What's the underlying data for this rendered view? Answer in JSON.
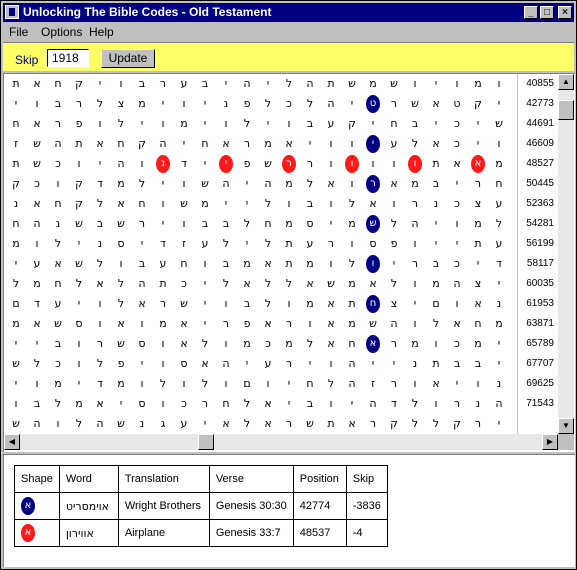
{
  "window": {
    "title": "Unlocking The Bible Codes - Old Testament"
  },
  "menu": [
    "File",
    "Options",
    "Help"
  ],
  "toolbar": {
    "skip_label": "Skip",
    "skip_value": "1918",
    "update_label": "Update"
  },
  "grid": {
    "rows": [
      "ומויושמשתהליהיבערבויקחאתלאהבתוםי",
      "יקטאשרהיהלכלפניוימצלרבויברכיהוהאל",
      "שיכיבחיקעבוילוימוילופראחר",
      "ויכאלעשוויאמראחיהקחאתהשזמוינצא",
      "משאתחוואורנשפוידלוהיוכשתחרהויהם",
      "חריבמאדואלמהיהשוילמדקוכקלתהיתכו",
      "עצכנרואלובוליימשוחאלקחאנתאמוריי",
      "למויהלומיסמחלבבוירשבשנהחליםיונה",
      "עתייופסורעתלילעזדיסנילומויליה",
      "דיכבריאלומתאמבוחעבולשאעיהלצשמית",
      "יצהמולאמשאללאליכתהלאלחמלויועדם",
      "נאוםיצמתאמולבוישראלויעדםיחינימויה",
      "מחאלוהשמאוראפריאמואוסשאמרשביה",
      "ימכומרוחאלמכמולאוסשרובייונתיכם",
      "יבבתנייהוירעיהאסויפלוכלשיתויקחו",
      "נויאורזהלחיוםולולומדימויחיהמרה",
      "הנרולדהיוביאלחרכוסיאמלבוויחקיחעשותי",
      "ירקללקראתשראלאיעגנשהלוהשאלקהי"
    ],
    "positions": [
      "40855",
      "42773",
      "44691",
      "46609",
      "48527",
      "50445",
      "52363",
      "54281",
      "56199",
      "58117",
      "60035",
      "61953",
      "63871",
      "65789",
      "67707",
      "69625",
      "71543"
    ]
  },
  "results": {
    "headers": [
      "Shape",
      "Word",
      "Translation",
      "Verse",
      "Position",
      "Skip"
    ],
    "rows": [
      {
        "shape_letter": "א",
        "shape_color": "#000080",
        "word": "אוימסריט",
        "translation": "Wright Brothers",
        "verse": "Genesis 30:30",
        "position": "42774",
        "skip": "-3836"
      },
      {
        "shape_letter": "א",
        "shape_color": "#ff1a1a",
        "word": "אווירון",
        "translation": "Airplane",
        "verse": "Genesis 33:7",
        "position": "48537",
        "skip": "-4"
      }
    ]
  },
  "highlights": {
    "blue": [
      {
        "row": 1,
        "col": 6,
        "ch": "ט"
      },
      {
        "row": 3,
        "col": 6,
        "ch": "י"
      },
      {
        "row": 5,
        "col": 6,
        "ch": "ר"
      },
      {
        "row": 7,
        "col": 6,
        "ch": "ש"
      },
      {
        "row": 9,
        "col": 6,
        "ch": "ו"
      },
      {
        "row": 11,
        "col": 6,
        "ch": "ח"
      },
      {
        "row": 13,
        "col": 6,
        "ch": "א"
      }
    ],
    "red": [
      {
        "row": 4,
        "col": 1,
        "ch": "א"
      },
      {
        "row": 4,
        "col": 4,
        "ch": "ו"
      },
      {
        "row": 4,
        "col": 7,
        "ch": "ו"
      },
      {
        "row": 4,
        "col": 10,
        "ch": "ר"
      },
      {
        "row": 4,
        "col": 13,
        "ch": "י"
      },
      {
        "row": 4,
        "col": 16,
        "ch": "נ"
      }
    ]
  }
}
